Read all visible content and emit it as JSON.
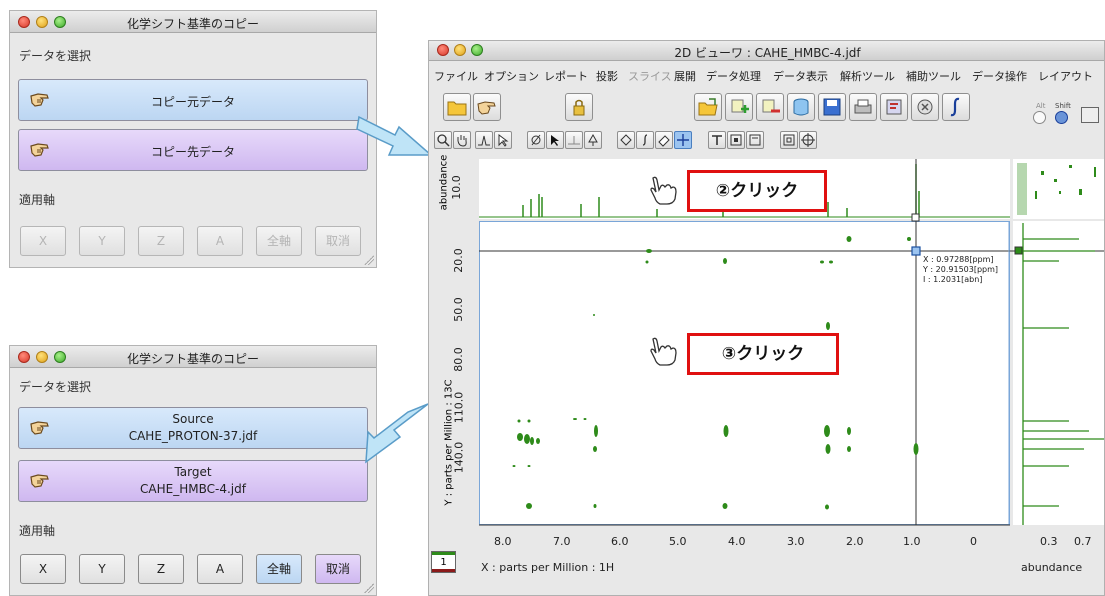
{
  "dialog1": {
    "title": "化学シフト基準のコピー",
    "select_label": "データを選択",
    "source_button": "コピー元データ",
    "target_button": "コピー先データ",
    "axis_label": "適用軸",
    "axis_buttons": [
      "X",
      "Y",
      "Z",
      "A",
      "全軸",
      "取消"
    ]
  },
  "dialog2": {
    "title": "化学シフト基準のコピー",
    "select_label": "データを選択",
    "source_title": "Source",
    "source_file": "CAHE_PROTON-37.jdf",
    "target_title": "Target",
    "target_file": "CAHE_HMBC-4.jdf",
    "axis_label": "適用軸",
    "axis_buttons": [
      "X",
      "Y",
      "Z",
      "A",
      "全軸",
      "取消"
    ]
  },
  "main_window": {
    "title": "2D ビューワ : CAHE_HMBC-4.jdf",
    "menu": [
      "ファイル",
      "オプション",
      "レポート",
      "投影",
      "スライス",
      "展開",
      "データ処理",
      "データ表示",
      "解析ツール",
      "補助ツール",
      "データ操作",
      "レイアウト"
    ],
    "modifier_alt": "Alt",
    "modifier_shift": "Shift",
    "top_axis_label": "abundance",
    "top_axis_tick": "10.0",
    "y_axis_label": "Y : parts per Million : 13C",
    "y_ticks": [
      "20.0",
      "50.0",
      "80.0",
      "110.0",
      "140.0"
    ],
    "x_ticks": [
      "8.0",
      "7.0",
      "6.0",
      "5.0",
      "4.0",
      "3.0",
      "2.0",
      "1.0",
      "0"
    ],
    "x_axis_label": "X : parts per Million : 1H",
    "right_ticks": [
      "0.3",
      "0.7"
    ],
    "right_axis_label": "abundance",
    "page_number": "1",
    "cursor_readout": [
      "X : 0.97288[ppm]",
      "Y : 20.91503[ppm]",
      "I : 1.2031[abn]"
    ],
    "callout_click2": "②クリック",
    "callout_click3": "③クリック"
  },
  "colors": {
    "peak_green": "#2e8b1a",
    "callout_border": "#e01010",
    "arrow_fill": "#bfe4f7",
    "source_blue": "#cfe2f8",
    "target_purple": "#dbc8f5"
  }
}
